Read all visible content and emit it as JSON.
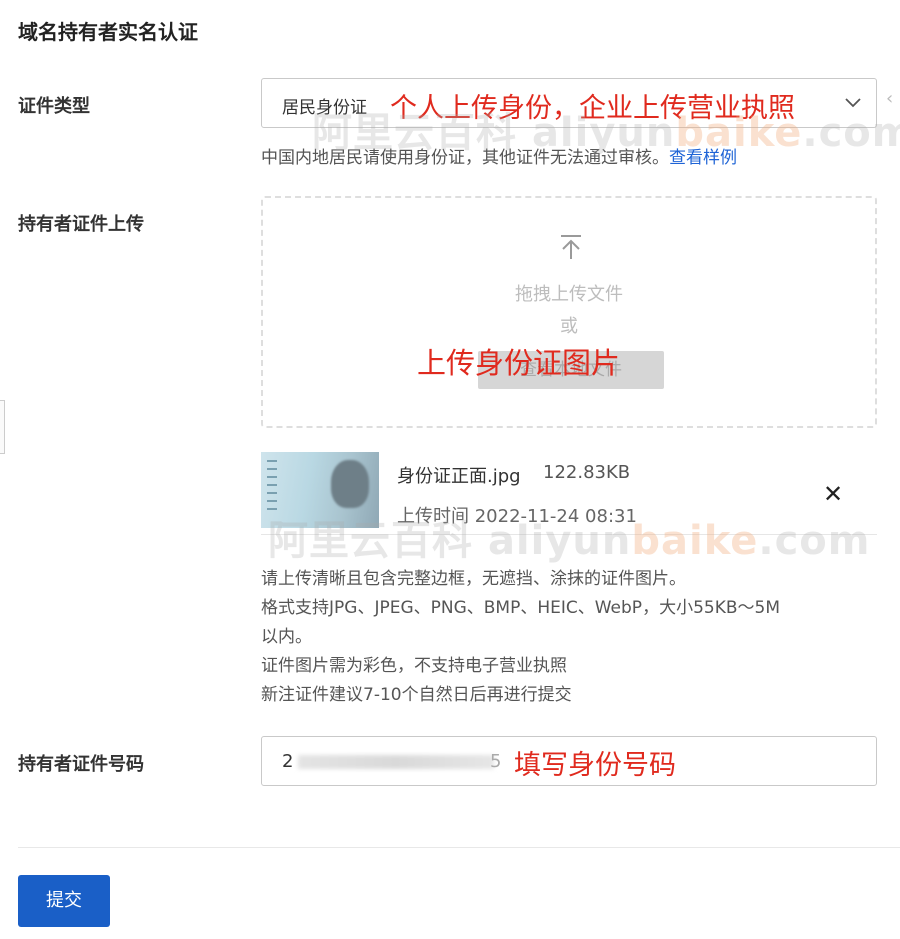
{
  "page": {
    "title": "域名持有者实名认证"
  },
  "cert_type": {
    "label": "证件类型",
    "value": "居民身份证",
    "annotation": "个人上传身份，企业上传营业执照",
    "hint": "中国内地居民请使用身份证，其他证件无法通过审核。",
    "hint_link": "查看样例"
  },
  "upload": {
    "label": "持有者证件上传",
    "drag_text": "拖拽上传文件",
    "or_text": "或",
    "button_label": "查看本地文件",
    "annotation": "上传身份证图片"
  },
  "file": {
    "name": "身份证正面.jpg",
    "size": "122.83KB",
    "time": "上传时间 2022-11-24 08:31"
  },
  "notes": [
    "请上传清晰且包含完整边框，无遮挡、涂抹的证件图片。",
    "格式支持JPG、JPEG、PNG、BMP、HEIC、WebP，大小55KB～5M",
    "以内。",
    "证件图片需为彩色，不支持电子营业执照",
    "新注证件建议7-10个自然日后再进行提交"
  ],
  "id_number": {
    "label": "持有者证件号码",
    "visible_prefix": "2",
    "visible_suffix": "5",
    "annotation": "填写身份号码"
  },
  "submit": {
    "label": "提交"
  },
  "watermark": {
    "cn": "阿里云百科",
    "en_a": "aliyun",
    "en_b": "baike",
    "en_c": ".com"
  },
  "colors": {
    "accent": "#1a5fc7",
    "link": "#1f64d6",
    "annotation": "#e02a1e"
  }
}
